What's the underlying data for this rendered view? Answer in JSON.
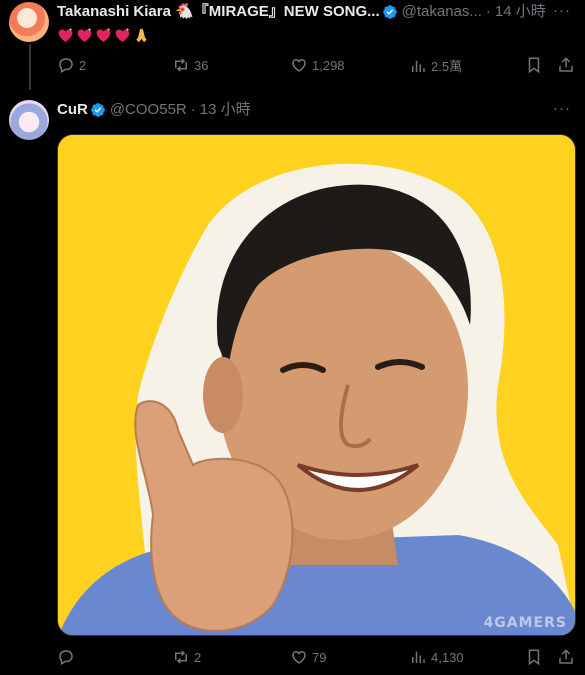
{
  "colors": {
    "background": "#000000",
    "text": "#e7e9ea",
    "muted": "#71767b",
    "verified": "#1d9bf0",
    "media_bg": "#ffd21f"
  },
  "tweets": [
    {
      "name": "Takanashi Kiara 🐔『MIRAGE』NEW SONG...",
      "handle": "@takanas...",
      "separator": "·",
      "time": "14 小時",
      "more": "···",
      "text_emoji": [
        "sparkling-heart",
        "sparkling-heart",
        "sparkling-heart",
        "sparkling-heart",
        "folded-hands"
      ],
      "replies": "2",
      "retweets": "36",
      "likes": "1,298",
      "views": "2.5萬"
    },
    {
      "name": "CuR",
      "handle": "@COO55R",
      "separator": "·",
      "time": "13 小時",
      "more": "···",
      "media": "Smiling man giving thumbs up on yellow background",
      "replies": "",
      "retweets": "2",
      "likes": "79",
      "views": "4,130"
    }
  ],
  "watermark": "4GAMERS"
}
